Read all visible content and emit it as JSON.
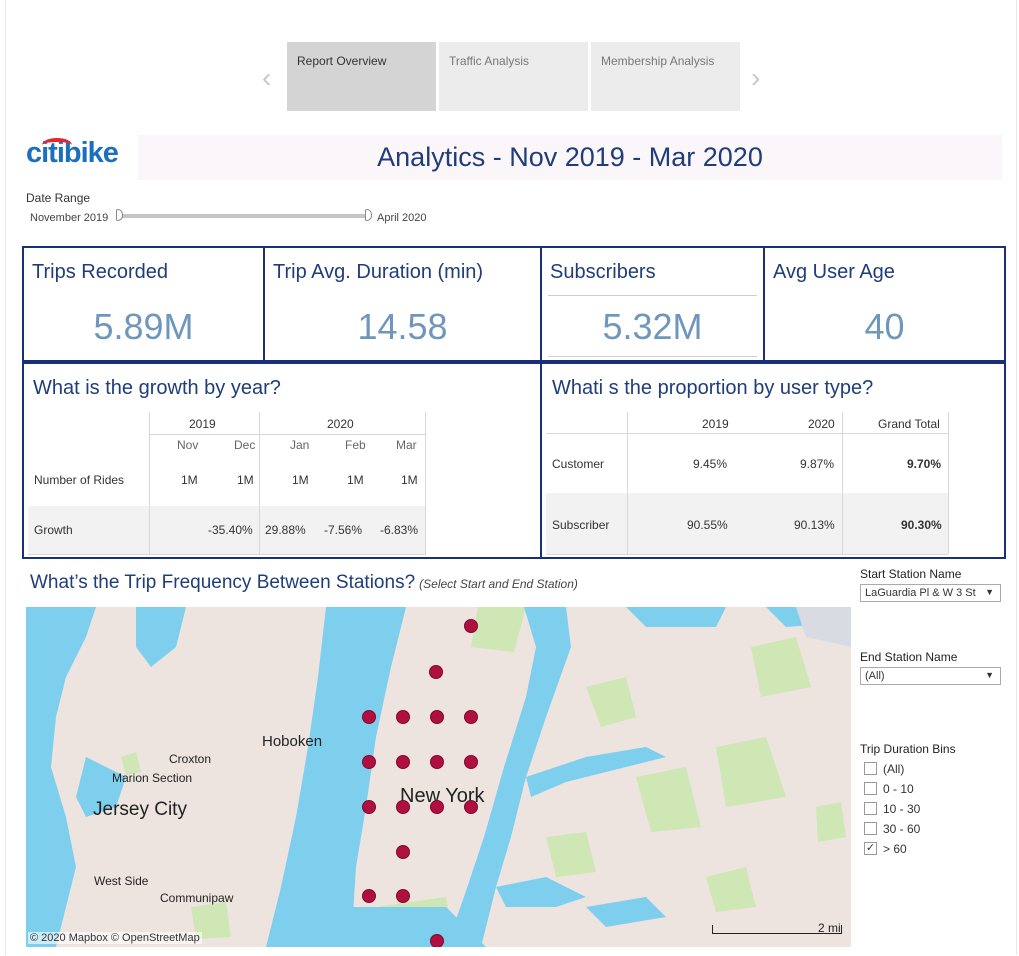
{
  "nav": {
    "tabs": [
      {
        "label": "Report Overview",
        "active": true
      },
      {
        "label": "Traffic Analysis",
        "active": false
      },
      {
        "label": "Membership Analysis",
        "active": false
      }
    ],
    "prev_arrow": "‹",
    "next_arrow": "›"
  },
  "header": {
    "logo_part1": "citi",
    "logo_part2": "bike",
    "title": "Analytics - Nov 2019 - Mar 2020"
  },
  "date_range": {
    "label": "Date Range",
    "start": "November 2019",
    "end": "April 2020"
  },
  "kpis": [
    {
      "title": "Trips Recorded",
      "value": "5.89M"
    },
    {
      "title": "Trip Avg. Duration (min)",
      "value": "14.58"
    },
    {
      "title": "Subscribers",
      "value": "5.32M"
    },
    {
      "title": "Avg User Age",
      "value": "40"
    }
  ],
  "growth": {
    "title": "What is the growth by year?",
    "years": [
      "2019",
      "2020"
    ],
    "months": [
      "Nov",
      "Dec",
      "Jan",
      "Feb",
      "Mar"
    ],
    "rows": [
      {
        "label": "Number of Rides",
        "values": [
          "1M",
          "1M",
          "1M",
          "1M",
          "1M"
        ]
      },
      {
        "label": "Growth",
        "values": [
          "",
          "-35.40%",
          "29.88%",
          "-7.56%",
          "-6.83%"
        ]
      }
    ]
  },
  "proportion": {
    "title": "Whati s the proportion by user type?",
    "columns": [
      "2019",
      "2020",
      "Grand Total"
    ],
    "rows": [
      {
        "label": "Customer",
        "values": [
          "9.45%",
          "9.87%",
          "9.70%"
        ]
      },
      {
        "label": "Subscriber",
        "values": [
          "90.55%",
          "90.13%",
          "90.30%"
        ]
      }
    ]
  },
  "map": {
    "title": "What’s the Trip Frequency Between Stations?",
    "subtitle": "(Select Start and End Station)",
    "labels": {
      "hoboken": "Hoboken",
      "croxton": "Croxton",
      "marion": "Marion Section",
      "jersey_city": "Jersey City",
      "new_york": "New York",
      "west_side": "West Side",
      "communipaw": "Communipaw",
      "scale": "2 mi",
      "attribution": "© 2020 Mapbox  © OpenStreetMap"
    },
    "colors": {
      "water": "#7ecfee",
      "land": "#ede4e0",
      "park": "#cfe6b5",
      "station": "#b0103f"
    }
  },
  "filters": {
    "start_label": "Start Station Name",
    "start_value": "LaGuardia Pl & W 3 St",
    "end_label": "End Station Name",
    "end_value": "(All)",
    "bins_label": "Trip Duration Bins",
    "bins": [
      {
        "label": "(All)",
        "checked": false
      },
      {
        "label": "0 - 10",
        "checked": false
      },
      {
        "label": "10 - 30",
        "checked": false
      },
      {
        "label": "30 - 60",
        "checked": false
      },
      {
        "label": "> 60",
        "checked": true
      }
    ]
  }
}
